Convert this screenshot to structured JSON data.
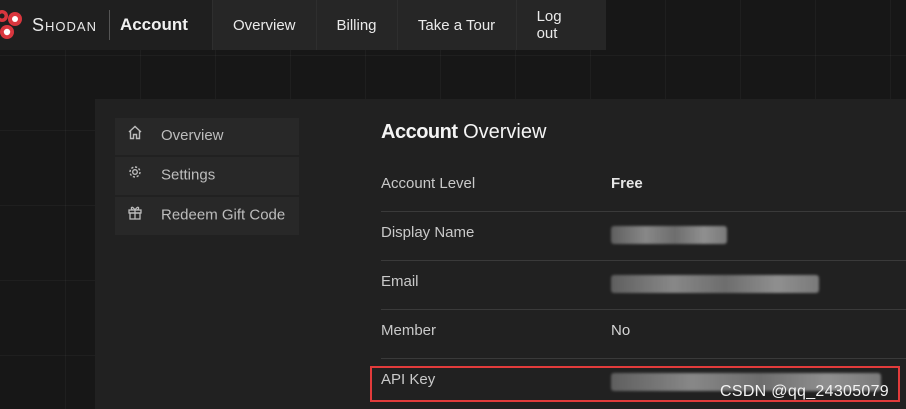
{
  "header": {
    "brand_name": "Shodan",
    "section": "Account",
    "nav": [
      "Overview",
      "Billing",
      "Take a Tour",
      "Log out"
    ]
  },
  "sidebar": {
    "items": [
      {
        "label": "Overview",
        "icon": "home-icon"
      },
      {
        "label": "Settings",
        "icon": "gear-icon"
      },
      {
        "label": "Redeem Gift Code",
        "icon": "gift-icon"
      }
    ]
  },
  "main": {
    "title_bold": "Account",
    "title_light": "Overview",
    "rows": [
      {
        "label": "Account Level",
        "value": "Free"
      },
      {
        "label": "Display Name",
        "value": ""
      },
      {
        "label": "Email",
        "value": ""
      },
      {
        "label": "Member",
        "value": "No"
      },
      {
        "label": "API Key",
        "value": ""
      }
    ]
  },
  "watermark": "CSDN @qq_24305079",
  "colors": {
    "highlight": "#e23b3b",
    "logo_red": "#d9363e"
  }
}
